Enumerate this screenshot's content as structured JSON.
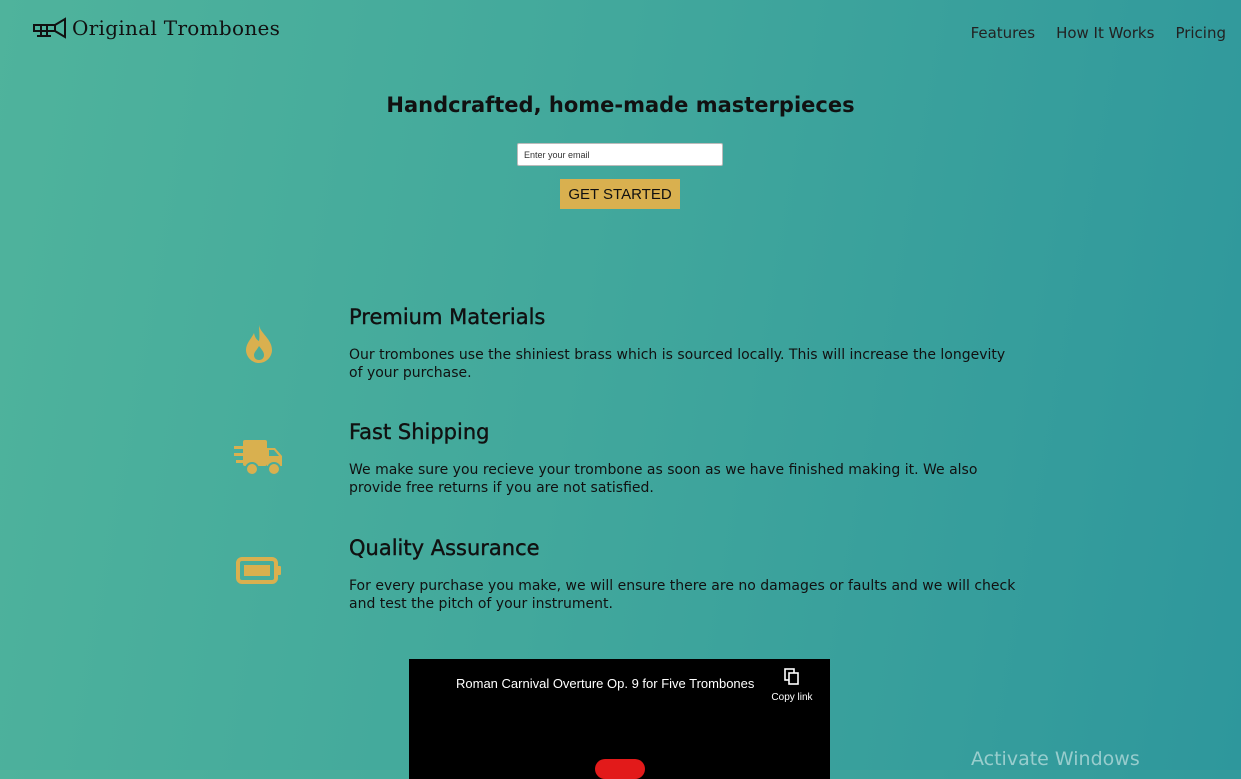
{
  "brand": {
    "name": "Original Trombones",
    "logo_icon": "trombone-icon"
  },
  "nav": {
    "items": [
      "Features",
      "How It Works",
      "Pricing"
    ]
  },
  "hero": {
    "title": "Handcrafted, home-made masterpieces",
    "email_placeholder": "Enter your email",
    "cta": "GET STARTED"
  },
  "features": [
    {
      "icon": "fire-icon",
      "title": "Premium Materials",
      "text": "Our trombones use the shiniest brass which is sourced locally. This will increase the longevity of your purchase."
    },
    {
      "icon": "truck-icon",
      "title": "Fast Shipping",
      "text": "We make sure you recieve your trombone as soon as we have finished making it. We also provide free returns if you are not satisfied."
    },
    {
      "icon": "battery-icon",
      "title": "Quality Assurance",
      "text": "For every purchase you make, we will ensure there are no damages or faults and we will check and test the pitch of your instrument."
    }
  ],
  "video": {
    "title": "Roman Carnival Overture Op. 9 for Five Trombones",
    "copy_label": "Copy link"
  },
  "watermark": "Activate Windows",
  "colors": {
    "accent": "#d9b04f",
    "gradient_start": "#4fb39c",
    "gradient_end": "#2e979c"
  }
}
